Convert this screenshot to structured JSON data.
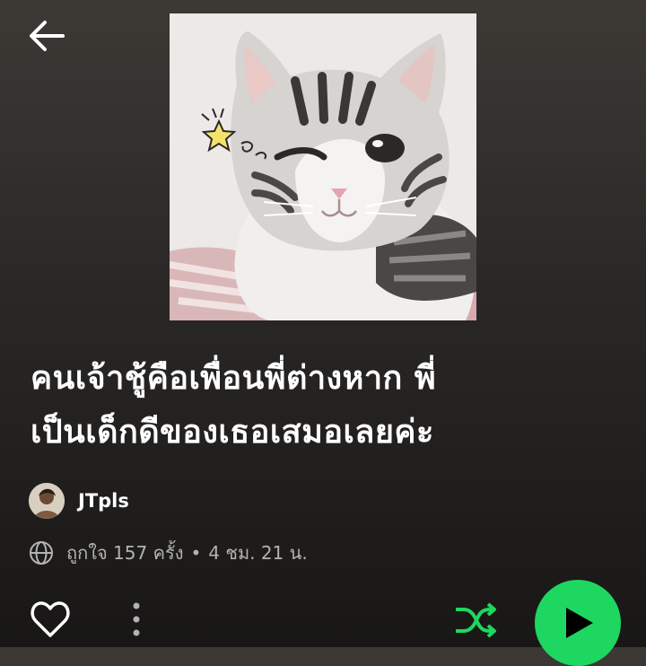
{
  "header": {
    "back_icon": "arrow-left-icon"
  },
  "playlist": {
    "title_line1": "คนเจ้าชู้คือเพื่อนพี่ต่างหาก พี่",
    "title_line2": "เป็นเด็กดีของเธอเสมอเลยค่ะ",
    "owner_name": "JTpls",
    "likes_text": "ถูกใจ 157 ครั้ง",
    "separator": "•",
    "duration_text": "4 ชม. 21 น."
  },
  "actions": {
    "like_icon": "heart-outline-icon",
    "more_icon": "more-vertical-icon",
    "shuffle_icon": "shuffle-icon",
    "play_icon": "play-icon"
  },
  "colors": {
    "accent_green": "#1ed760",
    "text_primary": "#ffffff",
    "text_secondary": "#b3b3b3"
  }
}
